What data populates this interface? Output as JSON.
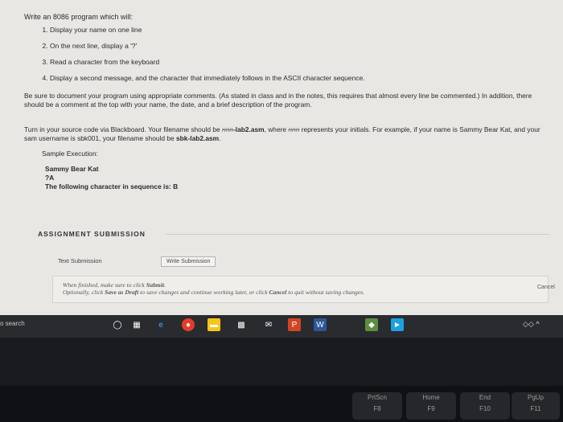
{
  "assignment": {
    "intro": "Write an 8086 program which will:",
    "steps": [
      "Display your name on one line",
      "On the next line, display a '?'",
      "Read a character from the keyboard",
      "Display a second message, and the character that immediately follows in the ASCII character sequence."
    ],
    "note_documentation": "Be sure to document your program using appropriate comments. (As stated in class and in the notes, this requires that almost every line be commented.) In addition, there should be a comment at the top with your name, the date, and a brief description of the program.",
    "note_filename_prefix": "Turn in your source code via Blackboard. Your filename should be ",
    "note_filename_initials": "nnn",
    "note_filename_bold": "-lab2.asm",
    "note_filename_mid": ", where ",
    "note_filename_initials2": "nnn",
    "note_filename_rest": " represents your initials.   For example, if your name is Sammy Bear Kat, and your sam username is sbk001, your filename should be ",
    "note_filename_example": "sbk-lab2.asm",
    "sample_label": "Sample Execution:",
    "sample_lines": [
      "Sammy Bear Kat",
      "?A",
      "The following character in sequence is: B"
    ]
  },
  "submission": {
    "title": "ASSIGNMENT SUBMISSION",
    "tab_text": "Text Submission",
    "tab_write": "Write Submission",
    "hint_line1_prefix": "When finished, make sure to click ",
    "hint_line1_bold": "Submit",
    "hint_line2_prefix": "Optionally, click ",
    "hint_line2_bold": "Save as Draft",
    "hint_line2_mid": " to save changes and continue working later, or click ",
    "hint_line2_bold2": "Cancel",
    "hint_line2_rest": " to quit without saving changes.",
    "cancel_label": "Cancel"
  },
  "taskbar": {
    "search_label": "o search",
    "icons": [
      "task-view-icon",
      "edge-icon",
      "chrome-icon",
      "file-explorer-icon",
      "store-icon",
      "mail-icon",
      "powerpoint-icon",
      "word-icon",
      "app-icon",
      "app2-icon"
    ],
    "tray_label": "◇◇  ^"
  },
  "keyboard": {
    "keys": [
      "PrtScn",
      "Home",
      "End",
      "PgUp"
    ],
    "sublabels": [
      "F8",
      "F9",
      "F10",
      "F11"
    ]
  }
}
